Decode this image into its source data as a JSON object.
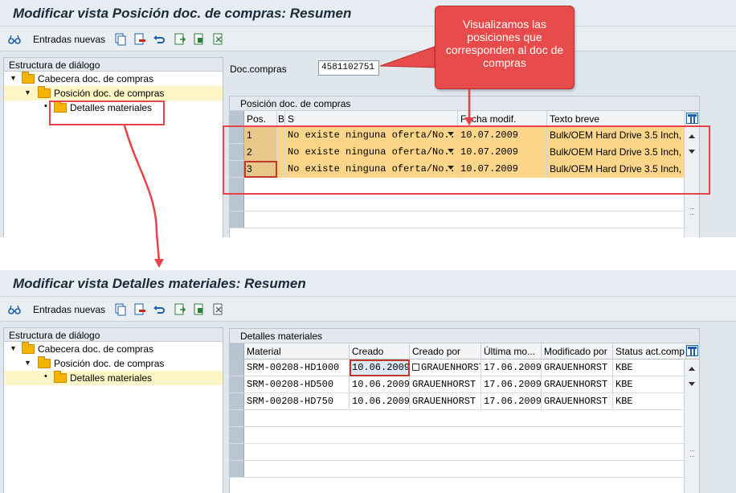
{
  "screen1": {
    "title": "Modificar vista Posición doc. de compras: Resumen",
    "toolbar_label": "Entradas nuevas",
    "tree_header": "Estructura de diálogo",
    "tree_items": [
      "Cabecera doc. de compras",
      "Posición doc. de compras",
      "Detalles materiales"
    ],
    "field_label": "Doc.compras",
    "field_value": "4581102751",
    "panel_title": "Posición doc. de compras",
    "columns": [
      "Pos.",
      "B",
      "S",
      "Fecha modif.",
      "Texto breve"
    ],
    "rows": [
      {
        "pos": "1",
        "s": "No existe ninguna oferta/No...",
        "fecha": "10.07.2009",
        "texto": "Bulk/OEM Hard Drive 3.5 Inch,"
      },
      {
        "pos": "2",
        "s": "No existe ninguna oferta/No...",
        "fecha": "10.07.2009",
        "texto": "Bulk/OEM Hard Drive 3.5 Inch,"
      },
      {
        "pos": "3",
        "s": "No existe ninguna oferta/No...",
        "fecha": "10.07.2009",
        "texto": "Bulk/OEM Hard Drive 3.5 Inch,"
      }
    ]
  },
  "callout": "Visualizamos las posiciones que corresponden al doc de compras",
  "screen2": {
    "title": "Modificar vista Detalles materiales: Resumen",
    "toolbar_label": "Entradas nuevas",
    "tree_header": "Estructura de diálogo",
    "tree_items": [
      "Cabecera doc. de compras",
      "Posición doc. de compras",
      "Detalles materiales"
    ],
    "panel_title": "Detalles materiales",
    "columns": [
      "Material",
      "Creado",
      "Creado por",
      "Última mo...",
      "Modificado por",
      "Status act.comp"
    ],
    "rows": [
      {
        "material": "SRM-00208-HD1000",
        "creado": "10.06.2009",
        "creado_por": "GRAUENHORST",
        "ultima": "17.06.2009",
        "modificado_por": "GRAUENHORST",
        "status": "KBE"
      },
      {
        "material": "SRM-00208-HD500",
        "creado": "10.06.2009",
        "creado_por": "GRAUENHORST",
        "ultima": "17.06.2009",
        "modificado_por": "GRAUENHORST",
        "status": "KBE"
      },
      {
        "material": "SRM-00208-HD750",
        "creado": "10.06.2009",
        "creado_por": "GRAUENHORST",
        "ultima": "17.06.2009",
        "modificado_por": "GRAUENHORST",
        "status": "KBE"
      }
    ]
  },
  "colors": {
    "accent": "#e8424a",
    "row_highlight": "#fbd68a",
    "folder": "#f5b400"
  }
}
